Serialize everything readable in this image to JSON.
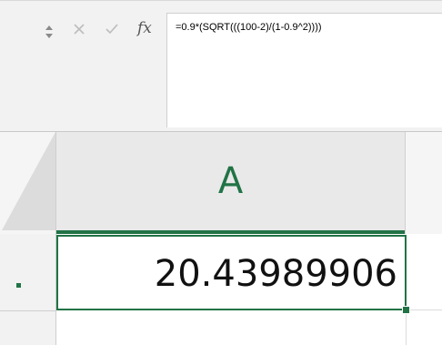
{
  "formula_bar": {
    "cancel_icon": "close-icon",
    "enter_icon": "checkmark-icon",
    "fx_label": "fx",
    "formula": "=0.9*(SQRT(((100-2)/(1-0.9^2))))"
  },
  "grid": {
    "column_header": "A",
    "row_next_label": ")",
    "cells": {
      "a1": "20.43989906"
    }
  },
  "colors": {
    "accent": "#217346",
    "header_bg": "#e9e9e9",
    "formula_bg": "#f2f2f2"
  }
}
